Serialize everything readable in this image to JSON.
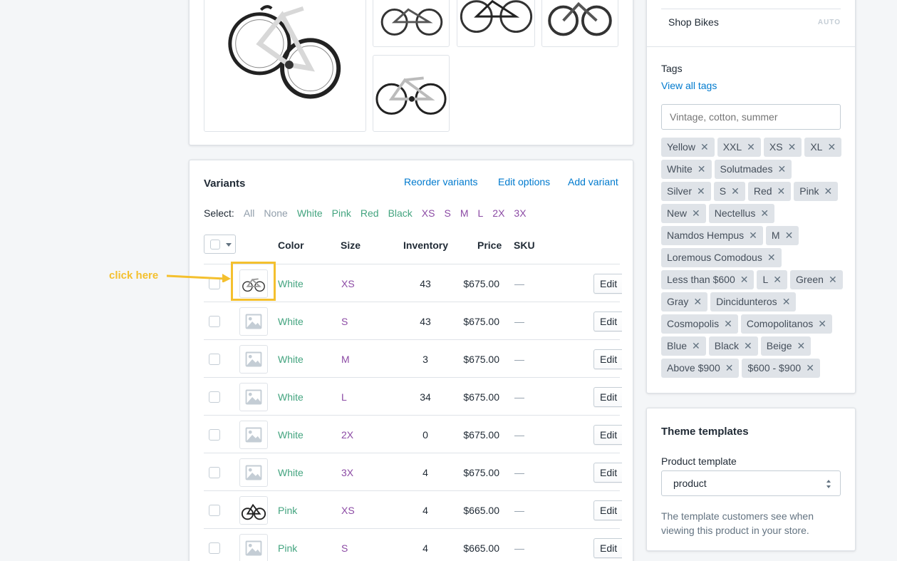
{
  "variants": {
    "title": "Variants",
    "actions": [
      "Reorder variants",
      "Edit options",
      "Add variant"
    ],
    "select_label": "Select:",
    "select_options": [
      {
        "label": "All",
        "style": "muted"
      },
      {
        "label": "None",
        "style": "muted"
      },
      {
        "label": "White",
        "style": "green"
      },
      {
        "label": "Pink",
        "style": "green"
      },
      {
        "label": "Red",
        "style": "green"
      },
      {
        "label": "Black",
        "style": "green"
      },
      {
        "label": "XS",
        "style": "purple"
      },
      {
        "label": "S",
        "style": "purple"
      },
      {
        "label": "M",
        "style": "purple"
      },
      {
        "label": "L",
        "style": "purple"
      },
      {
        "label": "2X",
        "style": "purple"
      },
      {
        "label": "3X",
        "style": "purple"
      }
    ],
    "columns": {
      "color": "Color",
      "size": "Size",
      "inventory": "Inventory",
      "price": "Price",
      "sku": "SKU"
    },
    "edit_label": "Edit",
    "rows": [
      {
        "image": "bike-white",
        "color": "White",
        "size": "XS",
        "inventory": "43",
        "price": "$675.00",
        "sku": "—"
      },
      {
        "image": "placeholder",
        "color": "White",
        "size": "S",
        "inventory": "43",
        "price": "$675.00",
        "sku": "—"
      },
      {
        "image": "placeholder",
        "color": "White",
        "size": "M",
        "inventory": "3",
        "price": "$675.00",
        "sku": "—"
      },
      {
        "image": "placeholder",
        "color": "White",
        "size": "L",
        "inventory": "34",
        "price": "$675.00",
        "sku": "—"
      },
      {
        "image": "placeholder",
        "color": "White",
        "size": "2X",
        "inventory": "0",
        "price": "$675.00",
        "sku": "—"
      },
      {
        "image": "placeholder",
        "color": "White",
        "size": "3X",
        "inventory": "4",
        "price": "$675.00",
        "sku": "—"
      },
      {
        "image": "bike-black",
        "color": "Pink",
        "size": "XS",
        "inventory": "4",
        "price": "$665.00",
        "sku": "—"
      },
      {
        "image": "placeholder",
        "color": "Pink",
        "size": "S",
        "inventory": "4",
        "price": "$665.00",
        "sku": "—"
      }
    ]
  },
  "annotation": {
    "text": "click here",
    "color": "#f4c02e"
  },
  "organization": {
    "collection": "Shop Bikes",
    "collection_badge": "AUTO",
    "tags_label": "Tags",
    "tags_link": "View all tags",
    "tags_placeholder": "Vintage, cotton, summer",
    "tags": [
      "Yellow",
      "XXL",
      "XS",
      "XL",
      "White",
      "Solutmades",
      "Silver",
      "S",
      "Red",
      "Pink",
      "New",
      "Nectellus",
      "Namdos Hempus",
      "M",
      "Loremous Comodous",
      "Less than $600",
      "L",
      "Green",
      "Gray",
      "Dincidunteros",
      "Cosmopolis",
      "Comopolitanos",
      "Blue",
      "Black",
      "Beige",
      "Above $900",
      "$600 - $900"
    ]
  },
  "theme": {
    "title": "Theme templates",
    "label": "Product template",
    "selected": "product",
    "help": "The template customers see when viewing this product in your store."
  },
  "colors": {
    "link": "#007ace",
    "green_option": "#43a47f",
    "purple_option": "#8c4ba5",
    "annotation": "#f4c02e"
  }
}
